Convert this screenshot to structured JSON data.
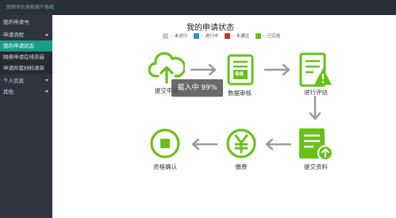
{
  "app": {
    "title": "职称评价系统用户系统"
  },
  "sidebar": {
    "items": [
      {
        "label": "我的申请书"
      },
      {
        "label": "申请流程"
      },
      {
        "label": "我的申请状态"
      },
      {
        "label": "网络申请在线答疑"
      },
      {
        "label": "申请所需材料清单"
      },
      {
        "label": "个人信息"
      },
      {
        "label": "其他"
      }
    ]
  },
  "main": {
    "title": "我的申请状态",
    "legend": [
      {
        "label": "-- 未进行",
        "color": "#c8c8c8"
      },
      {
        "label": "-- 进行中",
        "color": "#2f8fd0"
      },
      {
        "label": "-- 未通过",
        "color": "#c0392b"
      },
      {
        "label": "-- 已完成",
        "color": "#6ac01a"
      }
    ],
    "steps": [
      {
        "label": "提交申请"
      },
      {
        "label": "数据审核",
        "icon_text": "审核"
      },
      {
        "label": "进行评估"
      },
      {
        "label": "提交资料"
      },
      {
        "label": "缴费"
      },
      {
        "label": "资格确认"
      }
    ],
    "loading": "载入中 99%",
    "accent": "#6ac01a"
  }
}
